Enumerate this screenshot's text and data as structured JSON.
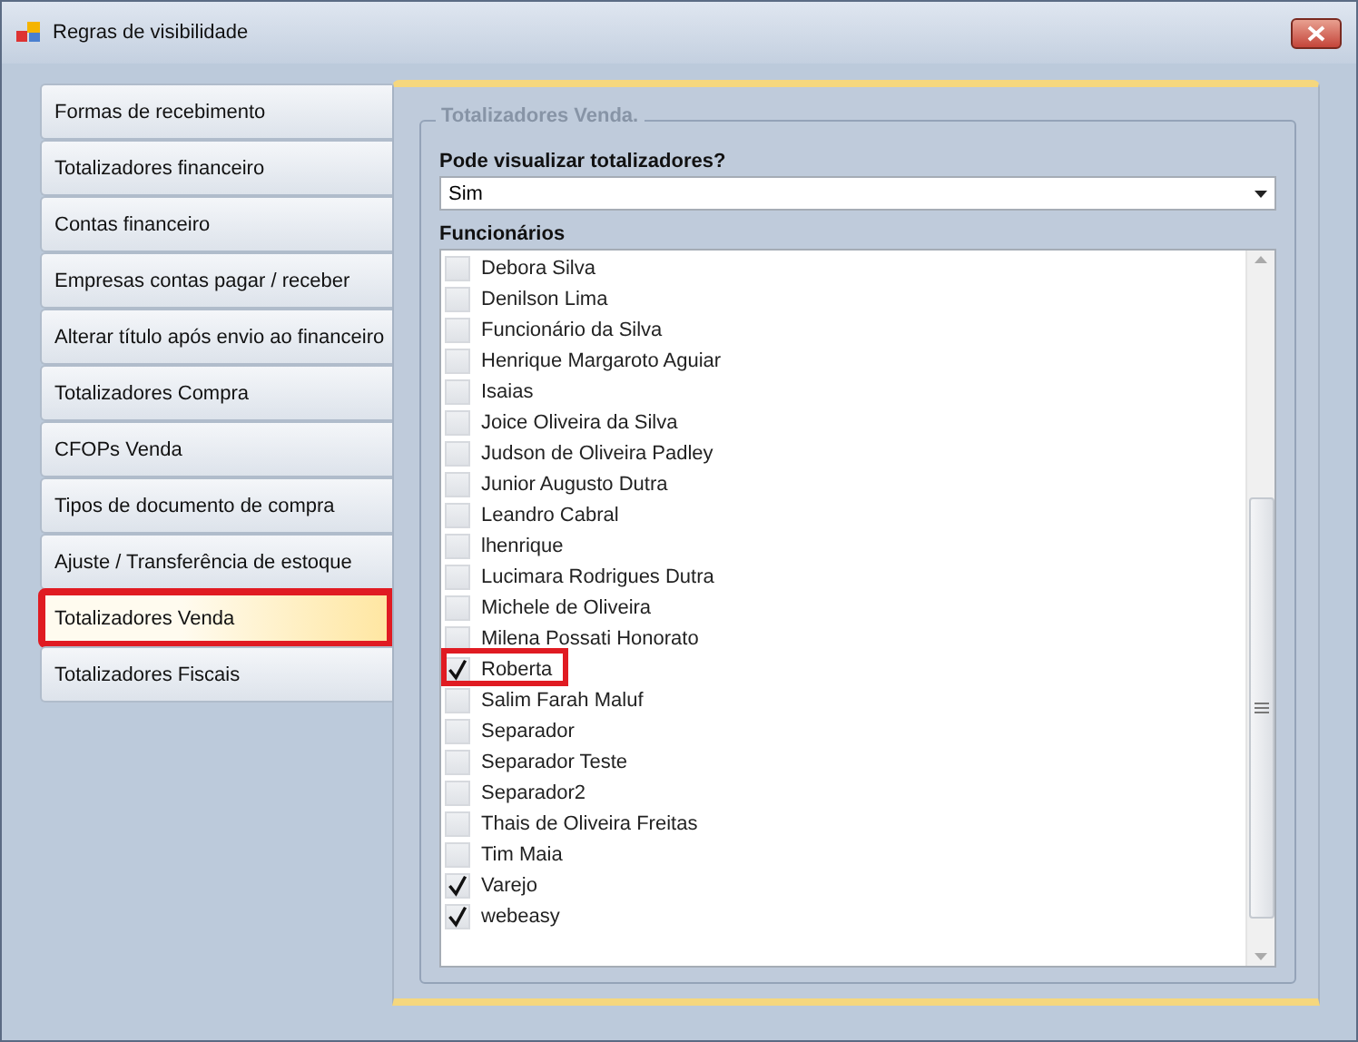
{
  "window": {
    "title": "Regras de visibilidade"
  },
  "tabs": [
    {
      "label": "Formas de recebimento",
      "selected": false,
      "highlighted": false
    },
    {
      "label": "Totalizadores financeiro",
      "selected": false,
      "highlighted": false
    },
    {
      "label": "Contas financeiro",
      "selected": false,
      "highlighted": false
    },
    {
      "label": "Empresas contas pagar / receber",
      "selected": false,
      "highlighted": false
    },
    {
      "label": "Alterar título após envio ao financeiro",
      "selected": false,
      "highlighted": false
    },
    {
      "label": "Totalizadores Compra",
      "selected": false,
      "highlighted": false
    },
    {
      "label": "CFOPs Venda",
      "selected": false,
      "highlighted": false
    },
    {
      "label": "Tipos de documento de compra",
      "selected": false,
      "highlighted": false
    },
    {
      "label": "Ajuste / Transferência de estoque",
      "selected": false,
      "highlighted": false
    },
    {
      "label": "Totalizadores Venda",
      "selected": true,
      "highlighted": true
    },
    {
      "label": "Totalizadores Fiscais",
      "selected": false,
      "highlighted": false
    }
  ],
  "group": {
    "title": "Totalizadores Venda.",
    "question": "Pode visualizar totalizadores?",
    "answer": "Sim",
    "list_label": "Funcionários"
  },
  "employees": [
    {
      "name": "Debora Silva",
      "checked": false,
      "highlighted": false
    },
    {
      "name": "Denilson Lima",
      "checked": false,
      "highlighted": false
    },
    {
      "name": "Funcionário da Silva",
      "checked": false,
      "highlighted": false
    },
    {
      "name": "Henrique Margaroto Aguiar",
      "checked": false,
      "highlighted": false
    },
    {
      "name": "Isaias",
      "checked": false,
      "highlighted": false
    },
    {
      "name": "Joice Oliveira da Silva",
      "checked": false,
      "highlighted": false
    },
    {
      "name": "Judson de Oliveira Padley",
      "checked": false,
      "highlighted": false
    },
    {
      "name": "Junior Augusto Dutra",
      "checked": false,
      "highlighted": false
    },
    {
      "name": "Leandro Cabral",
      "checked": false,
      "highlighted": false
    },
    {
      "name": "lhenrique",
      "checked": false,
      "highlighted": false
    },
    {
      "name": "Lucimara Rodrigues Dutra",
      "checked": false,
      "highlighted": false
    },
    {
      "name": "Michele de Oliveira",
      "checked": false,
      "highlighted": false
    },
    {
      "name": "Milena Possati Honorato",
      "checked": false,
      "highlighted": false
    },
    {
      "name": "Roberta",
      "checked": true,
      "highlighted": true
    },
    {
      "name": "Salim Farah Maluf",
      "checked": false,
      "highlighted": false
    },
    {
      "name": "Separador",
      "checked": false,
      "highlighted": false
    },
    {
      "name": "Separador Teste",
      "checked": false,
      "highlighted": false
    },
    {
      "name": "Separador2",
      "checked": false,
      "highlighted": false
    },
    {
      "name": "Thais de Oliveira Freitas",
      "checked": false,
      "highlighted": false
    },
    {
      "name": "Tim Maia",
      "checked": false,
      "highlighted": false
    },
    {
      "name": "Varejo",
      "checked": true,
      "highlighted": false
    },
    {
      "name": "webeasy",
      "checked": true,
      "highlighted": false
    }
  ]
}
